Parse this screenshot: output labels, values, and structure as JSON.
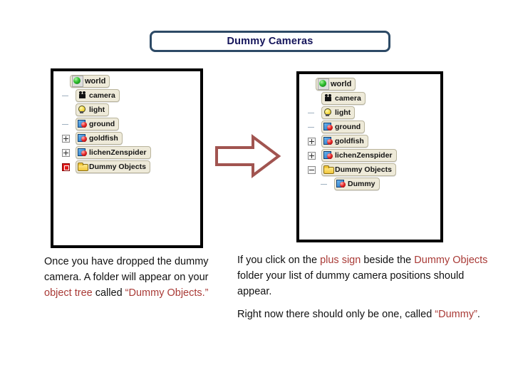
{
  "slide": {
    "title": "Dummy Cameras",
    "title_color": "#14145a",
    "title_border_color": "#2d4a66",
    "accent_red": "#a93a36",
    "arrow_color": "#a15450"
  },
  "panel_before": {
    "name": "object-tree-collapsed",
    "rows": [
      {
        "label": "world",
        "icon": "world-icon",
        "toggle": "none",
        "level": 0
      },
      {
        "label": "camera",
        "icon": "camera-icon",
        "toggle": "dash",
        "level": 1
      },
      {
        "label": "light",
        "icon": "light-icon",
        "toggle": "none",
        "level": 1
      },
      {
        "label": "ground",
        "icon": "object-icon",
        "toggle": "dash",
        "level": 1
      },
      {
        "label": "goldfish",
        "icon": "object-icon",
        "toggle": "plus",
        "level": 1
      },
      {
        "label": "lichenZenspider",
        "icon": "object-icon",
        "toggle": "plus",
        "level": 1
      },
      {
        "label": "Dummy Objects",
        "icon": "folder-icon",
        "toggle": "plus-highlighted",
        "level": 1
      }
    ]
  },
  "panel_after": {
    "name": "object-tree-expanded",
    "rows": [
      {
        "label": "world",
        "icon": "world-icon",
        "toggle": "none",
        "level": 0
      },
      {
        "label": "camera",
        "icon": "camera-icon",
        "toggle": "none",
        "level": 1
      },
      {
        "label": "light",
        "icon": "light-icon",
        "toggle": "dash",
        "level": 1
      },
      {
        "label": "ground",
        "icon": "object-icon",
        "toggle": "dash",
        "level": 1
      },
      {
        "label": "goldfish",
        "icon": "object-icon",
        "toggle": "plus",
        "level": 1
      },
      {
        "label": "lichenZenspider",
        "icon": "object-icon",
        "toggle": "plus",
        "level": 1
      },
      {
        "label": "Dummy Objects",
        "icon": "folder-icon",
        "toggle": "minus",
        "level": 1
      },
      {
        "label": "Dummy",
        "icon": "object-icon",
        "toggle": "dash",
        "level": 2
      }
    ]
  },
  "text_left": {
    "p1_a": "Once you have dropped the dummy camera. A folder will appear on your ",
    "p1_red1": "object tree",
    "p1_b": " called ",
    "p1_red2": "“Dummy Objects.”"
  },
  "text_right": {
    "p1_a": "If you click on the ",
    "p1_red1": "plus sign",
    "p1_b": " beside the ",
    "p1_red2": "Dummy Objects",
    "p1_c": " folder your list of dummy camera positions should appear.",
    "p2_a": "Right now there should only be one, called ",
    "p2_red1": "“Dummy”",
    "p2_b": "."
  }
}
